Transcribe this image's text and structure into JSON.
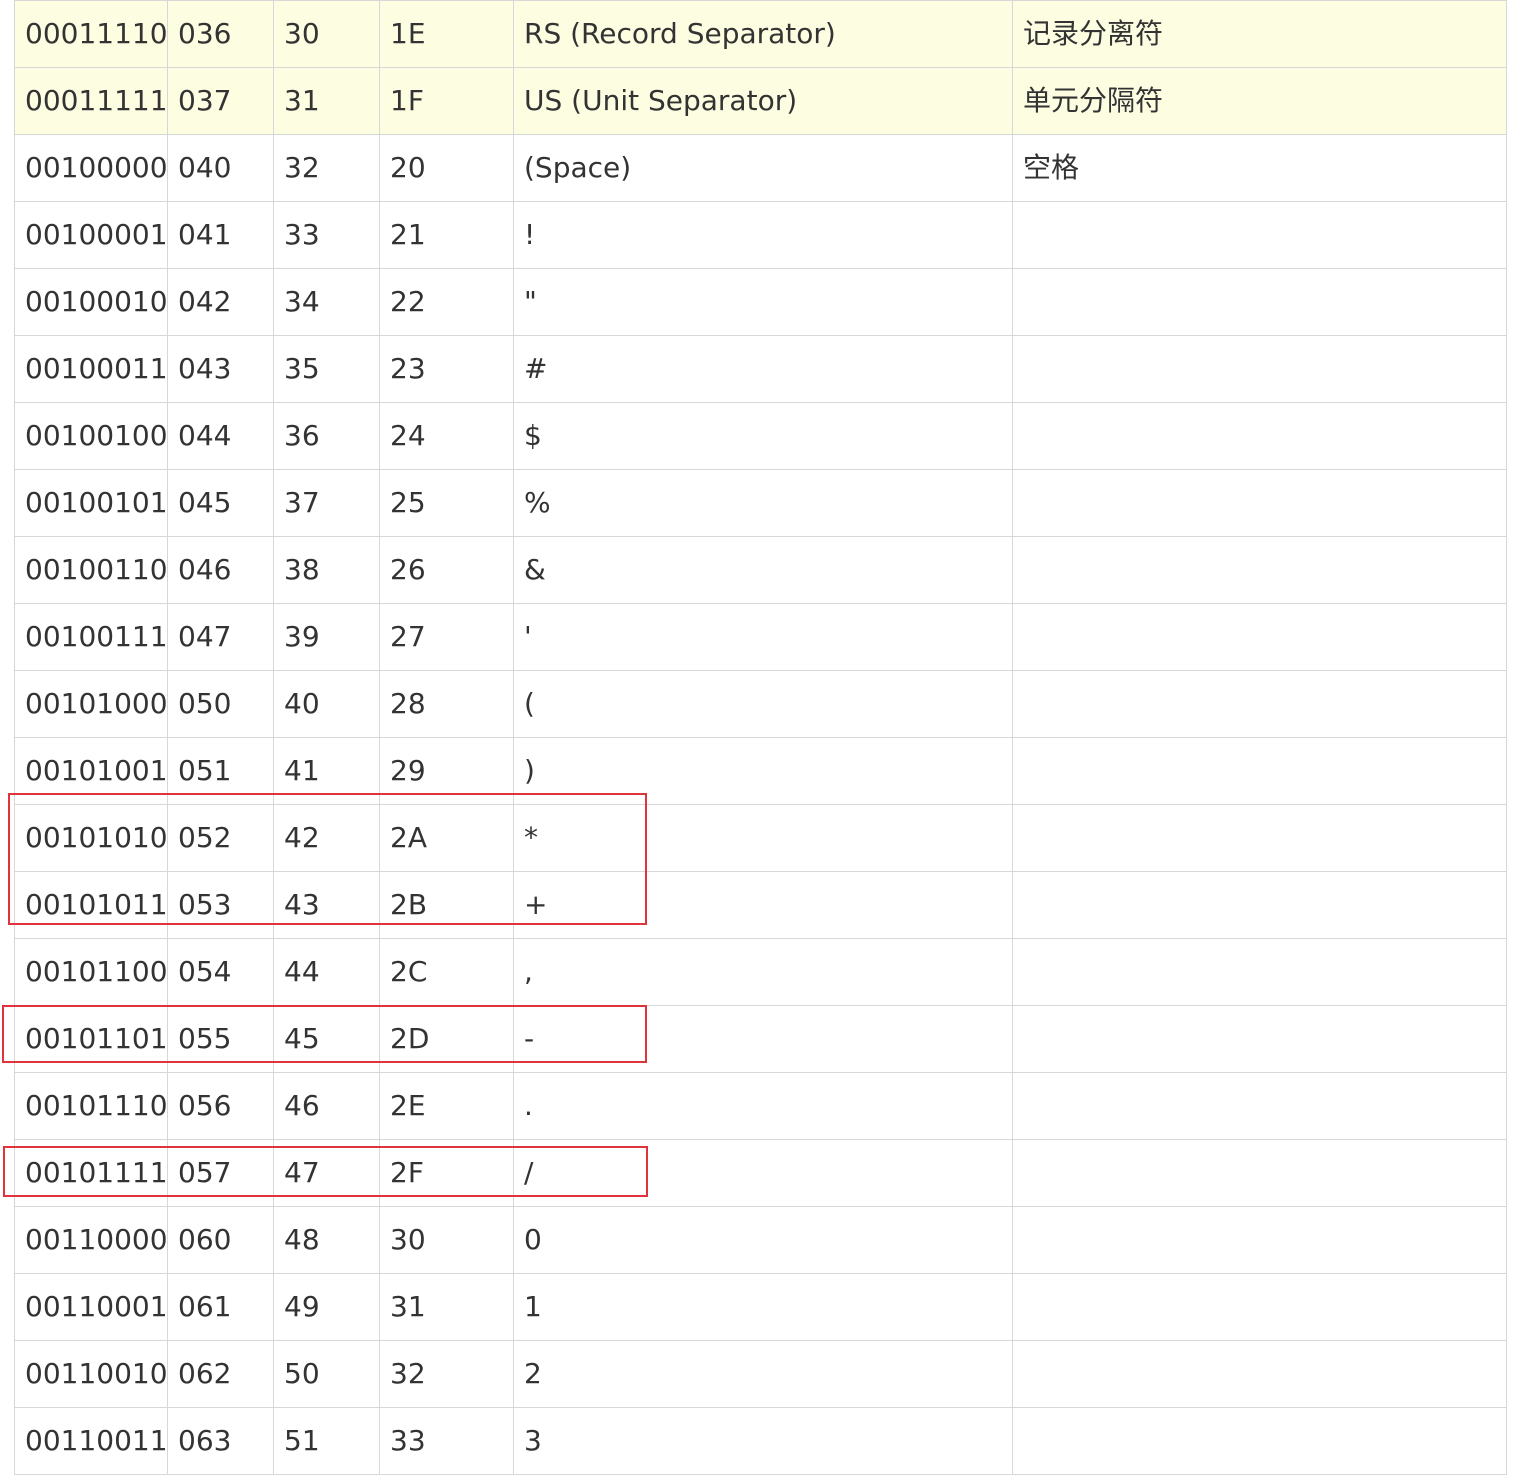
{
  "table": {
    "rows": [
      {
        "bin": "00011110",
        "oct": "036",
        "dec": "30",
        "hex": "1E",
        "abbr": "RS (Record Separator)",
        "desc": "记录分离符",
        "highlight": true
      },
      {
        "bin": "00011111",
        "oct": "037",
        "dec": "31",
        "hex": "1F",
        "abbr": "US (Unit Separator)",
        "desc": "单元分隔符",
        "highlight": true
      },
      {
        "bin": "00100000",
        "oct": "040",
        "dec": "32",
        "hex": "20",
        "abbr": "(Space)",
        "desc": "空格",
        "highlight": false
      },
      {
        "bin": "00100001",
        "oct": "041",
        "dec": "33",
        "hex": "21",
        "abbr": "!",
        "desc": "",
        "highlight": false
      },
      {
        "bin": "00100010",
        "oct": "042",
        "dec": "34",
        "hex": "22",
        "abbr": "\"",
        "desc": "",
        "highlight": false
      },
      {
        "bin": "00100011",
        "oct": "043",
        "dec": "35",
        "hex": "23",
        "abbr": "#",
        "desc": "",
        "highlight": false
      },
      {
        "bin": "00100100",
        "oct": "044",
        "dec": "36",
        "hex": "24",
        "abbr": "$",
        "desc": "",
        "highlight": false
      },
      {
        "bin": "00100101",
        "oct": "045",
        "dec": "37",
        "hex": "25",
        "abbr": "%",
        "desc": "",
        "highlight": false
      },
      {
        "bin": "00100110",
        "oct": "046",
        "dec": "38",
        "hex": "26",
        "abbr": "&",
        "desc": "",
        "highlight": false
      },
      {
        "bin": "00100111",
        "oct": "047",
        "dec": "39",
        "hex": "27",
        "abbr": "'",
        "desc": "",
        "highlight": false
      },
      {
        "bin": "00101000",
        "oct": "050",
        "dec": "40",
        "hex": "28",
        "abbr": "(",
        "desc": "",
        "highlight": false
      },
      {
        "bin": "00101001",
        "oct": "051",
        "dec": "41",
        "hex": "29",
        "abbr": ")",
        "desc": "",
        "highlight": false
      },
      {
        "bin": "00101010",
        "oct": "052",
        "dec": "42",
        "hex": "2A",
        "abbr": "*",
        "desc": "",
        "highlight": false
      },
      {
        "bin": "00101011",
        "oct": "053",
        "dec": "43",
        "hex": "2B",
        "abbr": "+",
        "desc": "",
        "highlight": false
      },
      {
        "bin": "00101100",
        "oct": "054",
        "dec": "44",
        "hex": "2C",
        "abbr": ",",
        "desc": "",
        "highlight": false
      },
      {
        "bin": "00101101",
        "oct": "055",
        "dec": "45",
        "hex": "2D",
        "abbr": "-",
        "desc": "",
        "highlight": false
      },
      {
        "bin": "00101110",
        "oct": "056",
        "dec": "46",
        "hex": "2E",
        "abbr": ".",
        "desc": "",
        "highlight": false
      },
      {
        "bin": "00101111",
        "oct": "057",
        "dec": "47",
        "hex": "2F",
        "abbr": "/",
        "desc": "",
        "highlight": false
      },
      {
        "bin": "00110000",
        "oct": "060",
        "dec": "48",
        "hex": "30",
        "abbr": "0",
        "desc": "",
        "highlight": false
      },
      {
        "bin": "00110001",
        "oct": "061",
        "dec": "49",
        "hex": "31",
        "abbr": "1",
        "desc": "",
        "highlight": false
      },
      {
        "bin": "00110010",
        "oct": "062",
        "dec": "50",
        "hex": "32",
        "abbr": "2",
        "desc": "",
        "highlight": false
      },
      {
        "bin": "00110011",
        "oct": "063",
        "dec": "51",
        "hex": "33",
        "abbr": "3",
        "desc": "",
        "highlight": false
      }
    ]
  },
  "annotations": {
    "box_color": "#e0343c",
    "boxed_rows": [
      [
        "2A",
        "2B"
      ],
      [
        "2D"
      ],
      [
        "2F"
      ]
    ]
  },
  "colors": {
    "highlight_row": "#fdfde2",
    "border": "#d7d7d7",
    "text": "#333333"
  }
}
